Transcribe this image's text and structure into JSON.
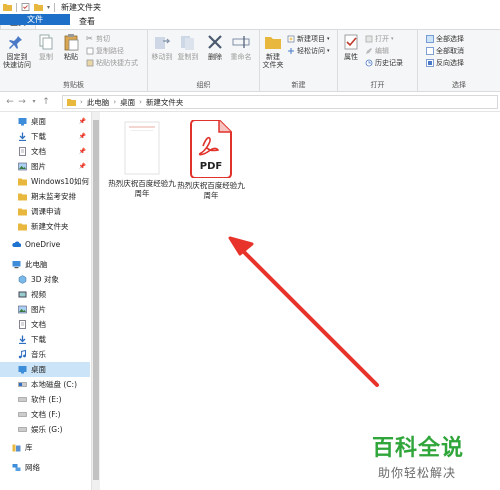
{
  "window": {
    "title": "新建文件夹"
  },
  "tabs": [
    {
      "label": "文件"
    },
    {
      "label": "主页"
    },
    {
      "label": "共享"
    },
    {
      "label": "查看"
    }
  ],
  "ribbon": {
    "clipboard": {
      "label": "剪贴板",
      "pin": "固定到\n快速访问",
      "copy": "复制",
      "paste": "粘贴",
      "cut": "剪切",
      "copy_path": "复制路径",
      "paste_shortcut": "粘贴快捷方式"
    },
    "organize": {
      "label": "组织",
      "move_to": "移动到",
      "copy_to": "复制到",
      "delete": "删除",
      "rename": "重命名"
    },
    "new": {
      "label": "新建",
      "new_folder": "新建\n文件夹",
      "new_item": "新建项目",
      "easy_access": "轻松访问"
    },
    "open": {
      "label": "打开",
      "properties": "属性",
      "open": "打开",
      "edit": "编辑",
      "history": "历史记录"
    },
    "select": {
      "label": "选择",
      "select_all": "全部选择",
      "select_none": "全部取消",
      "invert": "反向选择"
    }
  },
  "address": {
    "crumbs": [
      "此电脑",
      "桌面",
      "新建文件夹"
    ]
  },
  "sidebar": {
    "items": [
      {
        "label": "桌面",
        "icon": "desktop-folder-icon",
        "pinned": true
      },
      {
        "label": "下载",
        "icon": "download-icon",
        "pinned": true
      },
      {
        "label": "文档",
        "icon": "documents-icon",
        "pinned": true
      },
      {
        "label": "图片",
        "icon": "pictures-icon",
        "pinned": true
      },
      {
        "label": "Windows10如何",
        "icon": "folder-icon"
      },
      {
        "label": "期末监考安排",
        "icon": "folder-icon"
      },
      {
        "label": "调课申请",
        "icon": "folder-icon"
      },
      {
        "label": "新建文件夹",
        "icon": "folder-icon"
      },
      {
        "label": "OneDrive",
        "icon": "cloud-icon"
      },
      {
        "label": "此电脑",
        "icon": "computer-icon"
      },
      {
        "label": "3D 对象",
        "icon": "3d-objects-icon"
      },
      {
        "label": "视频",
        "icon": "video-icon"
      },
      {
        "label": "图片",
        "icon": "pictures-icon"
      },
      {
        "label": "文档",
        "icon": "documents-icon"
      },
      {
        "label": "下载",
        "icon": "download-icon"
      },
      {
        "label": "音乐",
        "icon": "music-icon"
      },
      {
        "label": "桌面",
        "icon": "desktop-folder-icon",
        "selected": true
      },
      {
        "label": "本地磁盘 (C:)",
        "icon": "drive-icon"
      },
      {
        "label": "软件 (E:)",
        "icon": "drive-icon"
      },
      {
        "label": "文档 (F:)",
        "icon": "drive-icon"
      },
      {
        "label": "娱乐 (G:)",
        "icon": "drive-icon"
      },
      {
        "label": "库",
        "icon": "library-icon"
      },
      {
        "label": "网络",
        "icon": "network-icon"
      }
    ]
  },
  "files": [
    {
      "name": "热烈庆祝百度经验九周年",
      "type": "document"
    },
    {
      "name": "热烈庆祝百度经验九周年",
      "type": "pdf",
      "badge": "PDF"
    }
  ],
  "watermark": {
    "line1": "百科全说",
    "line2": "助你轻松解决"
  },
  "colors": {
    "accent": "#1e6fc7",
    "selection": "#cce4f7",
    "arrow": "#e8332a",
    "pdf_red": "#e0322a",
    "brand_green": "#2fa53a"
  }
}
